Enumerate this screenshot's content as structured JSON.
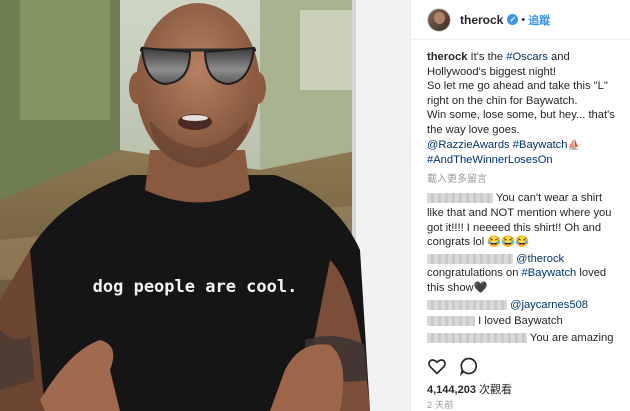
{
  "video": {
    "shirt_text": "dog people are cool."
  },
  "header": {
    "username": "therock",
    "dot": "•",
    "follow_label": "追蹤"
  },
  "caption": {
    "username": "therock",
    "line1": " It's the ",
    "tag_oscars": "#Oscars",
    "line1b": " and Hollywood's biggest night!",
    "line2": "So let me go ahead and take this \"L\" right on the chin for Baywatch.",
    "line3": "Win some, lose some, but hey... that's the way love goes.",
    "mention_razzie": "@RazzieAwards",
    "tag_baywatch": "#Baywatch",
    "tag_winner": "#AndTheWinnerLosesOn"
  },
  "load_more": "載入更多留言",
  "comments": [
    {
      "text": "You can't wear a shirt like that and NOT mention where you got it!!!! I neeeed this shirt!! Oh and congrats lol 😂😂😂"
    },
    {
      "mention": "@therock",
      "text": " congratulations on ",
      "tag": "#Baywatch",
      "text2": " loved this show🖤"
    },
    {
      "mention": "@jaycarnes508"
    },
    {
      "text": "I loved Baywatch"
    },
    {
      "text": "You are amazing"
    }
  ],
  "actions": {
    "like_icon": "heart-icon",
    "comment_icon": "comment-icon"
  },
  "views": {
    "count": "4,144,203",
    "label": " 次觀看"
  },
  "timestamp": "2 天前"
}
